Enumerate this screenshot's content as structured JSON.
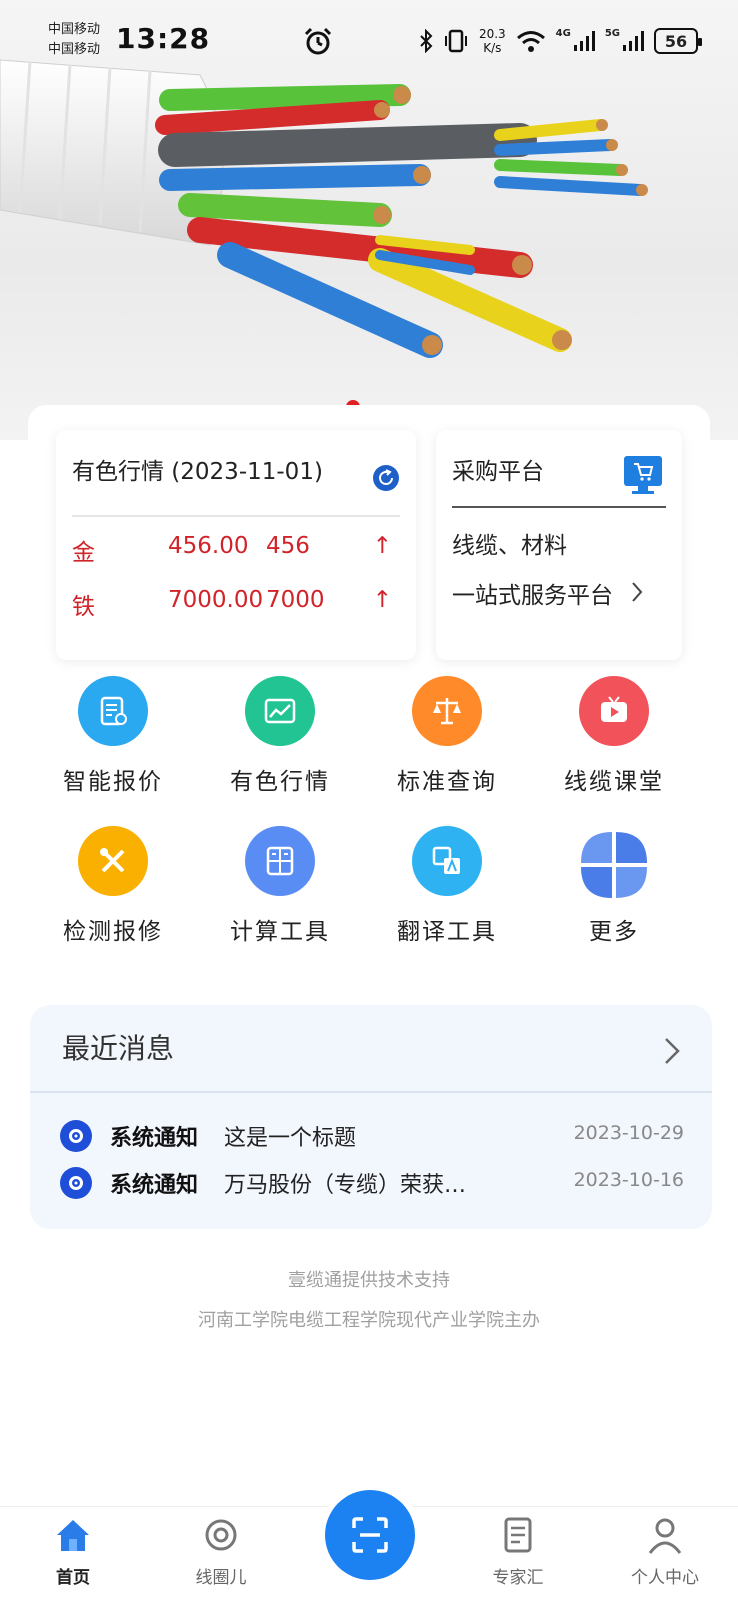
{
  "status_bar": {
    "carrier_1": "中国移动",
    "carrier_2": "中国移动",
    "time": "13:28",
    "net_speed_value": "20.3",
    "net_speed_unit": "K/s",
    "signal_1": "4G",
    "signal_2": "5G",
    "battery": "56"
  },
  "banner": {
    "active_slide": 1
  },
  "market_card": {
    "title": "有色行情 (2023-11-01)",
    "rows": [
      {
        "metal": "金",
        "price": "456.00",
        "value": "456",
        "trend": "↑"
      },
      {
        "metal": "铁",
        "price": "7000.00",
        "value": "7000",
        "trend": "↑"
      }
    ]
  },
  "purchase_card": {
    "title": "采购平台",
    "line1": "线缆、材料",
    "line2": "一站式服务平台"
  },
  "grid": [
    {
      "label": "智能报价",
      "icon": "quote-icon",
      "color": "#2aa8f0"
    },
    {
      "label": "有色行情",
      "icon": "chart-icon",
      "color": "#22c493"
    },
    {
      "label": "标准查询",
      "icon": "scale-icon",
      "color": "#ff8a2a"
    },
    {
      "label": "线缆课堂",
      "icon": "tv-icon",
      "color": "#f2525a"
    },
    {
      "label": "检测报修",
      "icon": "tools-icon",
      "color": "#f9b000"
    },
    {
      "label": "计算工具",
      "icon": "calculator-icon",
      "color": "#5a8df4"
    },
    {
      "label": "翻译工具",
      "icon": "translate-icon",
      "color": "#2fb2f2"
    },
    {
      "label": "更多",
      "icon": "more-icon",
      "color": "#4a7de8"
    }
  ],
  "messages": {
    "title": "最近消息",
    "items": [
      {
        "category": "系统通知",
        "text": "这是一个标题",
        "date": "2023-10-29"
      },
      {
        "category": "系统通知",
        "text": "万马股份（专缆）荣获…",
        "date": "2023-10-16"
      }
    ]
  },
  "footer": {
    "line1": "壹缆通提供技术支持",
    "line2": "河南工学院电缆工程学院现代产业学院主办"
  },
  "bottom_nav": {
    "items": [
      {
        "label": "首页",
        "icon": "home-icon"
      },
      {
        "label": "线圈儿",
        "icon": "circle-icon"
      },
      {
        "label": "专家汇",
        "icon": "document-icon"
      },
      {
        "label": "个人中心",
        "icon": "person-icon"
      }
    ],
    "center_icon": "scan-icon",
    "accent": "#1c82f2"
  }
}
